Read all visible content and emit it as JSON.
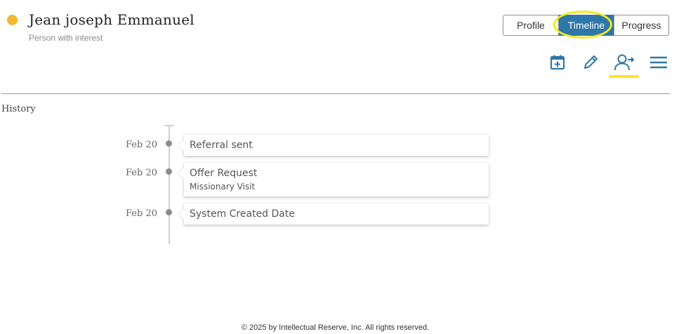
{
  "person": {
    "name": "Jean joseph Emmanuel",
    "status_label": "Person with interest",
    "status_color": "#f2b632"
  },
  "tabs": [
    {
      "label": "Profile",
      "active": false
    },
    {
      "label": "Timeline",
      "active": true
    },
    {
      "label": "Progress",
      "active": false
    }
  ],
  "actions": [
    {
      "icon": "calendar-add-icon"
    },
    {
      "icon": "pencil-edit-icon"
    },
    {
      "icon": "user-referral-icon"
    },
    {
      "icon": "hamburger-menu-icon"
    }
  ],
  "history": {
    "title": "History",
    "events": [
      {
        "date": "Feb 20",
        "title": "Referral sent",
        "detail": ""
      },
      {
        "date": "Feb 20",
        "title": "Offer Request",
        "detail": "Missionary Visit"
      },
      {
        "date": "Feb 20",
        "title": "System Created Date",
        "detail": ""
      }
    ]
  },
  "footer": {
    "text": "© 2025 by Intellectual Reserve, Inc. All rights reserved."
  },
  "colors": {
    "accent": "#2e77a9",
    "highlight": "#f4ea1a"
  }
}
